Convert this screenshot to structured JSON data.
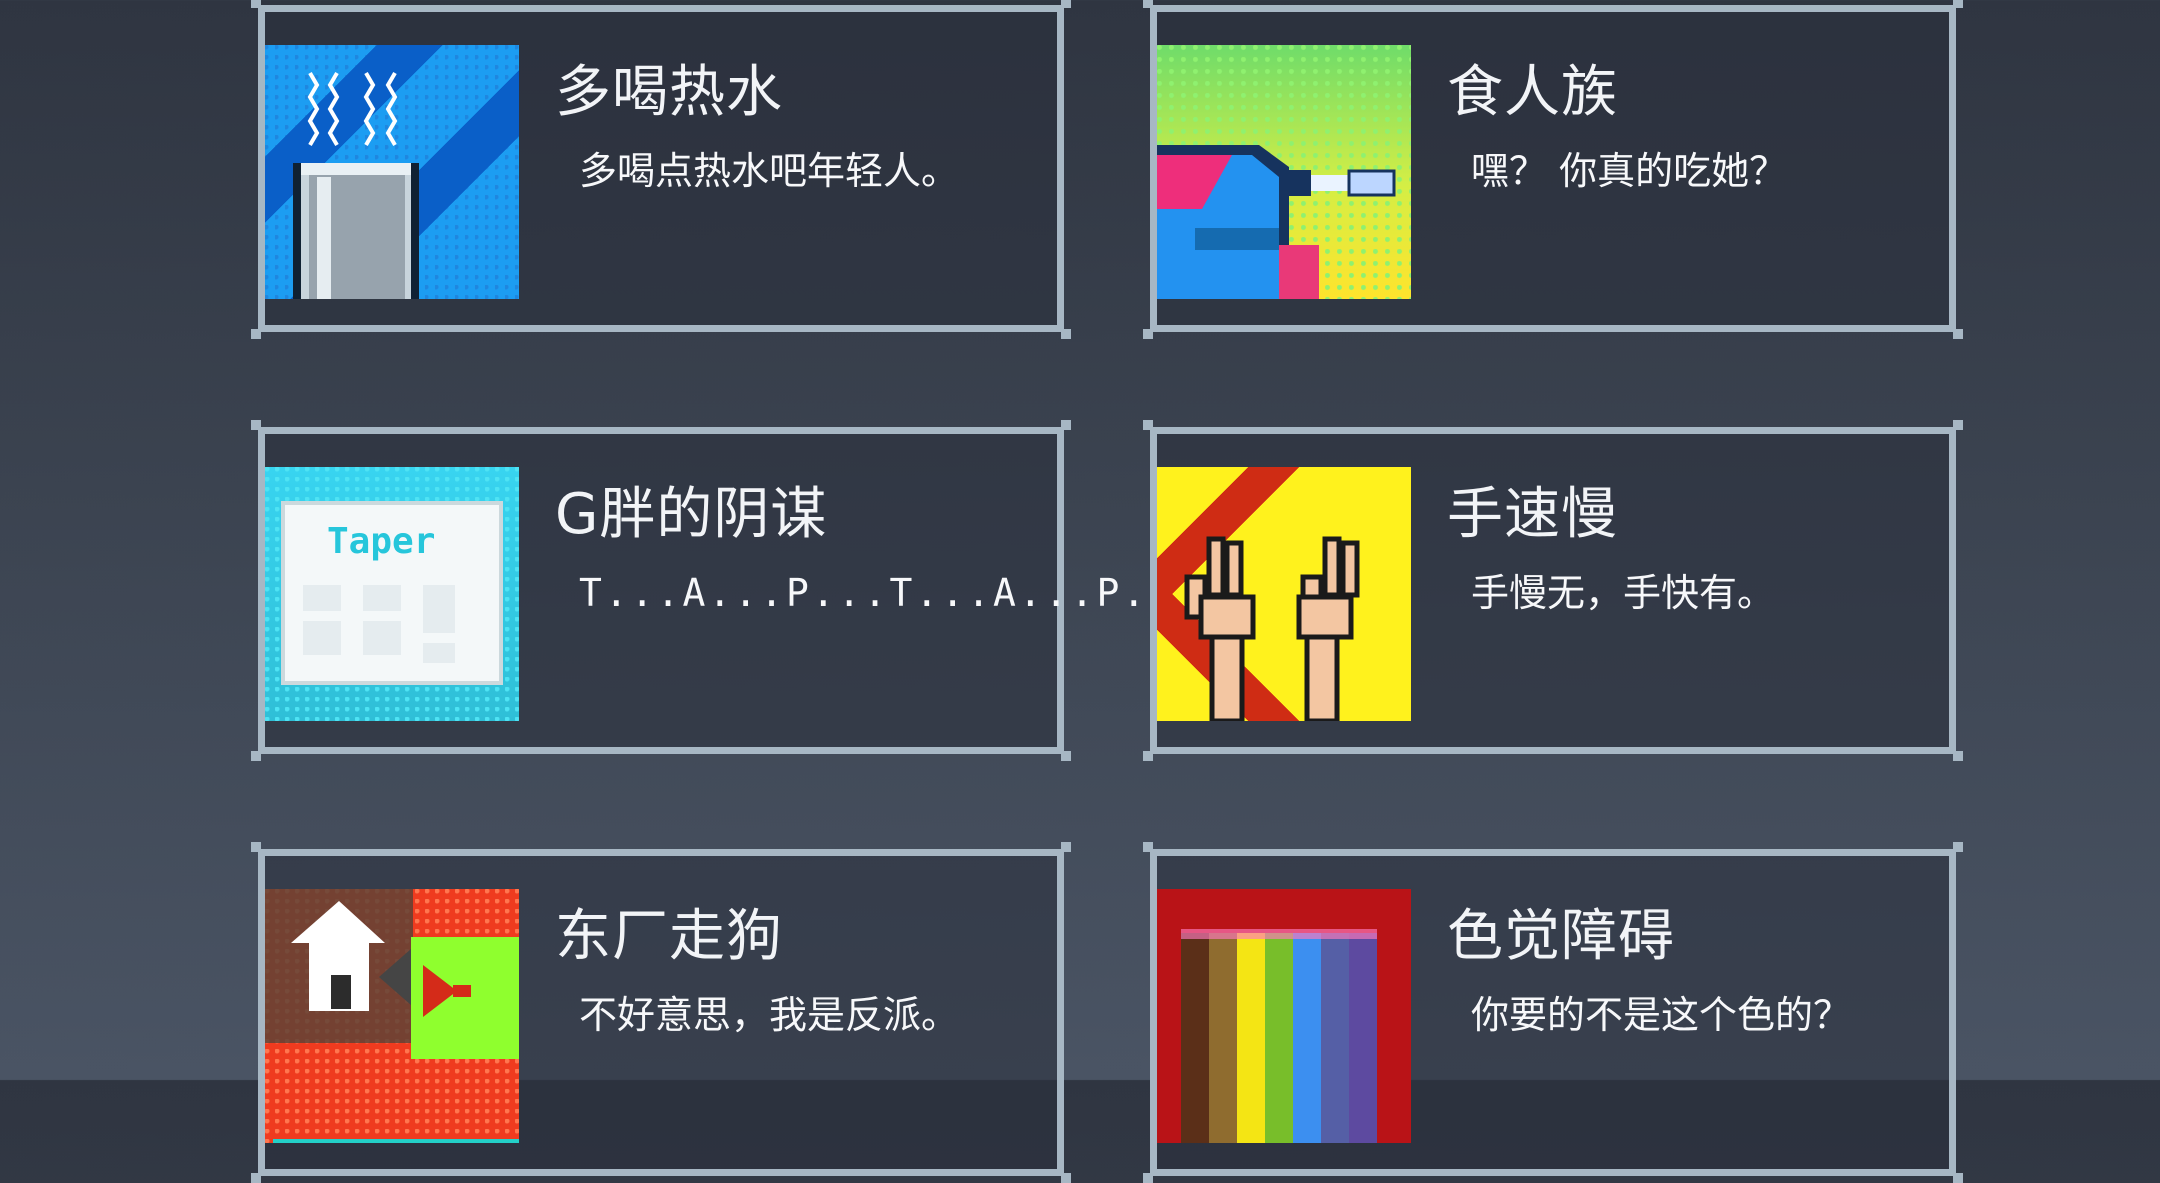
{
  "games": [
    {
      "title": "多喝热水",
      "description": "多喝点热水吧年轻人。",
      "thumb_icon": "hot-water-cup-icon",
      "accent": "#1c9df2"
    },
    {
      "title": "食人族",
      "description": "嘿？ 你真的吃她？",
      "thumb_icon": "cannibal-icon",
      "accent": "#ffe42c"
    },
    {
      "title": "G胖的阴谋",
      "description": "T...A...P...T...A...P...",
      "thumb_icon": "taper-document-icon",
      "thumb_text": "Taper",
      "accent": "#38d4f0"
    },
    {
      "title": "手速慢",
      "description": "手慢无，手快有。",
      "thumb_icon": "peace-hands-icon",
      "accent": "#fff21d"
    },
    {
      "title": "东厂走狗",
      "description": "不好意思，我是反派。",
      "thumb_icon": "house-arrow-icon",
      "accent": "#ef3b1f"
    },
    {
      "title": "色觉障碍",
      "description": "你要的不是这个色的？",
      "thumb_icon": "color-bars-icon",
      "accent": "#b91317"
    }
  ]
}
